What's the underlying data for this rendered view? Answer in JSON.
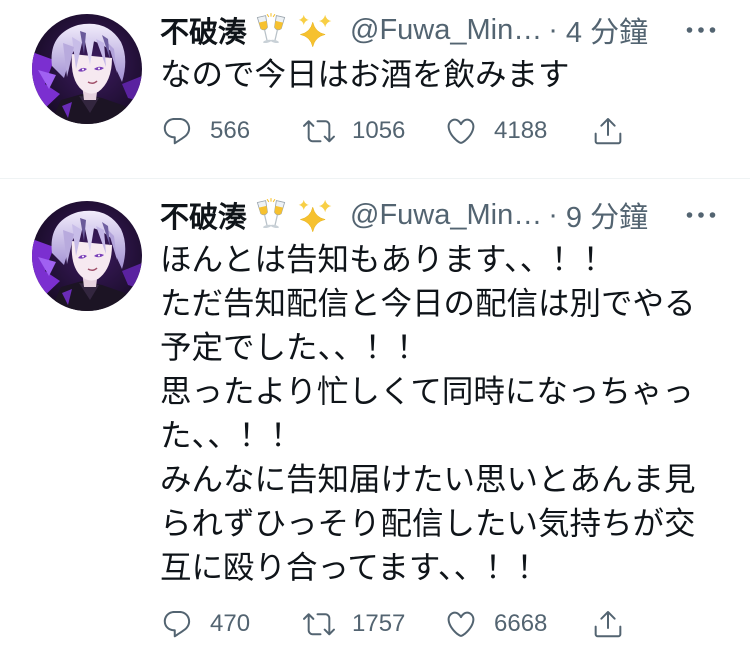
{
  "colors": {
    "background": "#ffffff",
    "text": "#0f1419",
    "secondary": "#536471",
    "divider": "#eff3f4",
    "emoji_gold": "#f6c12f"
  },
  "tweets": [
    {
      "author": {
        "display_name": "不破湊",
        "name_emoji_icons": [
          "clinking-glasses-icon",
          "sparkles-icon"
        ],
        "handle": "@Fuwa_Min…",
        "separator": "·",
        "time": "4 分鐘"
      },
      "more_icon": "more-icon",
      "text_lines": [
        "なので今日はお酒を飲みます"
      ],
      "actions": {
        "reply": {
          "icon": "reply-icon",
          "count": "566"
        },
        "retweet": {
          "icon": "retweet-icon",
          "count": "1056"
        },
        "like": {
          "icon": "heart-icon",
          "count": "4188"
        },
        "share": {
          "icon": "share-icon"
        }
      }
    },
    {
      "author": {
        "display_name": "不破湊",
        "name_emoji_icons": [
          "clinking-glasses-icon",
          "sparkles-icon"
        ],
        "handle": "@Fuwa_Min…",
        "separator": "·",
        "time": "9 分鐘"
      },
      "more_icon": "more-icon",
      "text_lines": [
        "ほんとは告知もあります、、！！",
        "ただ告知配信と今日の配信は別でやる",
        "予定でした、、！！",
        "思ったより忙しくて同時になっちゃっ",
        "た、、！！",
        "みんなに告知届けたい思いとあんま見",
        "られずひっそり配信したい気持ちが交",
        "互に殴り合ってます、、！！"
      ],
      "actions": {
        "reply": {
          "icon": "reply-icon",
          "count": "470"
        },
        "retweet": {
          "icon": "retweet-icon",
          "count": "1757"
        },
        "like": {
          "icon": "heart-icon",
          "count": "6668"
        },
        "share": {
          "icon": "share-icon"
        }
      }
    }
  ]
}
